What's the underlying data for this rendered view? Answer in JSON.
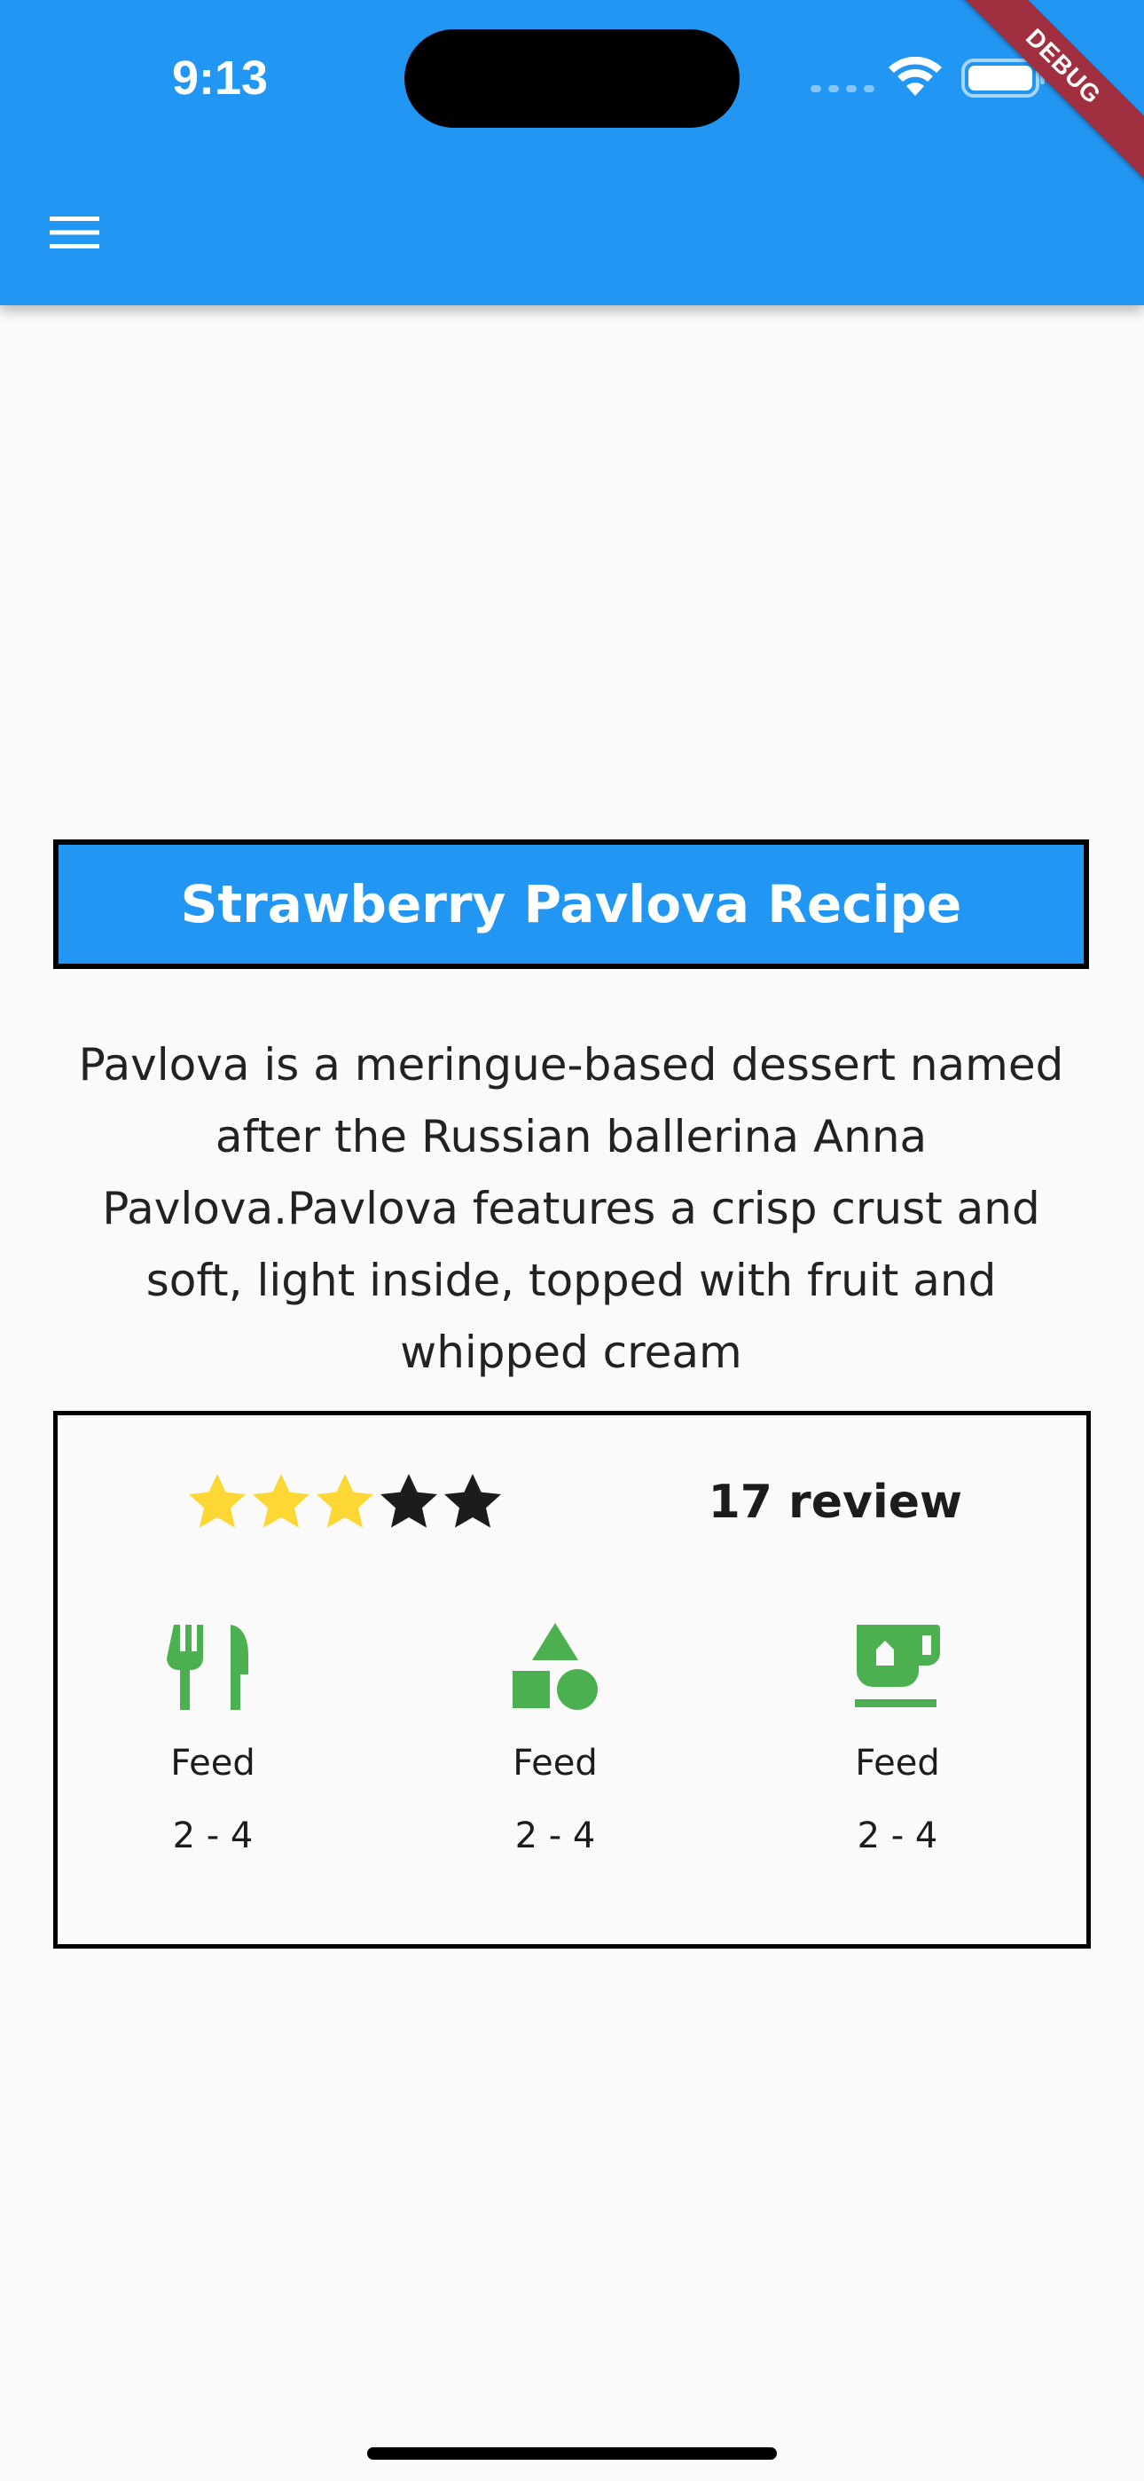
{
  "status_bar": {
    "time": "9:13",
    "signal_icon": "cellular-signal-icon",
    "wifi_icon": "wifi-icon",
    "battery_icon": "battery-icon"
  },
  "debug_banner": "DEBUG",
  "app_bar": {
    "menu_icon": "hamburger-menu-icon",
    "color": "#2196f3"
  },
  "recipe": {
    "title": "Strawberry Pavlova Recipe",
    "description": "Pavlova is a meringue-based dessert named after the Russian ballerina Anna Pavlova.Pavlova features a crisp crust and soft, light inside, topped with fruit and whipped cream"
  },
  "rating": {
    "stars_filled": 3,
    "stars_total": 5,
    "filled_color": "#fdd835",
    "empty_color": "#1c1c1c",
    "reviews": "17 review"
  },
  "features": [
    {
      "icon": "restaurant-icon",
      "label": "Feed",
      "value": "2 - 4"
    },
    {
      "icon": "category-shapes-icon",
      "label": "Feed",
      "value": "2 - 4"
    },
    {
      "icon": "free-breakfast-cup-icon",
      "label": "Feed",
      "value": "2 - 4"
    }
  ],
  "colors": {
    "accent": "#2196f3",
    "icon_green": "#4caf50",
    "background": "#fafafa"
  }
}
